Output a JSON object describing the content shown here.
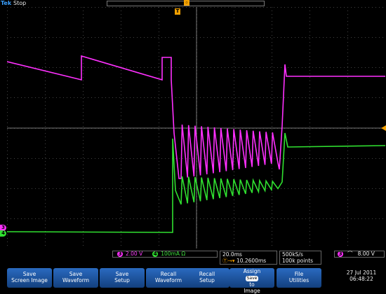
{
  "status": {
    "brand": "Tek",
    "run_state": "Stop",
    "trigger_position_marker": "T"
  },
  "channels": [
    {
      "id": "3",
      "color": "#ff30ff",
      "scale": "2.00 V"
    },
    {
      "id": "4",
      "color": "#30e030",
      "scale": "100mA Ω"
    }
  ],
  "timebase": {
    "scale": "20.0ms",
    "delay_prefix": "Ⓣ→▾",
    "delay": "10.2600ms"
  },
  "acquisition": {
    "sample_rate": "500kS/s",
    "record_length": "100k points"
  },
  "trigger": {
    "source": "3",
    "slope_symbol": "⌒",
    "level": "8.00 V"
  },
  "menu": {
    "items": [
      {
        "line1": "Save",
        "line2": "Screen Image"
      },
      {
        "line1": "Save",
        "line2": "Waveform"
      },
      {
        "line1": "Save",
        "line2": "Setup"
      },
      {
        "line1": "Recall",
        "line2": "Waveform"
      },
      {
        "line1": "Recall",
        "line2": "Setup"
      },
      {
        "line1": "Assign",
        "line2": "to",
        "line3": "Image",
        "badge": "Save"
      },
      {
        "line1": "File",
        "line2": "Utilities"
      }
    ]
  },
  "datetime": {
    "date": "27 Jul  2011",
    "time": "06:48:22"
  }
}
